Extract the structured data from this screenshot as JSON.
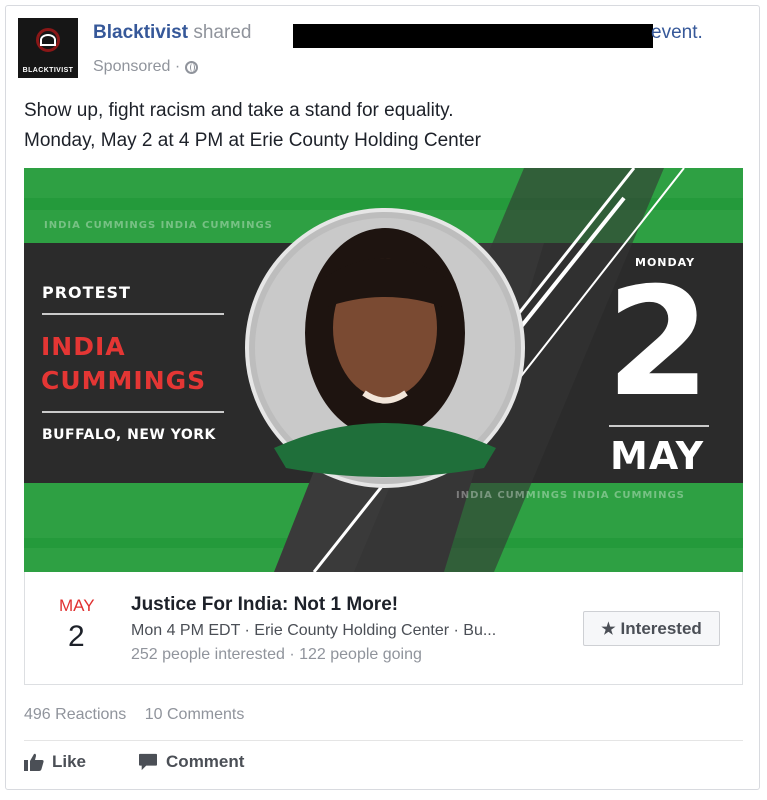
{
  "post": {
    "page_name": "Blacktivist",
    "shared_text": "shared",
    "event_word": "event.",
    "sponsored": "Sponsored ·",
    "avatar_text": "BLACKTIVIST",
    "message_line1": "Show up, fight racism and take a stand for equality.",
    "message_line2": "Monday, May 2 at 4 PM at Erie County Holding Center"
  },
  "banner": {
    "protest": "PROTEST",
    "name_line1": "INDIA",
    "name_line2": "CUMMINGS",
    "city": "BUFFALO, NEW YORK",
    "weekday": "MONDAY",
    "day": "2",
    "month": "MAY",
    "watermark": "INDIA CUMMINGS INDIA CUMMINGS"
  },
  "event": {
    "month": "MAY",
    "day": "2",
    "title": "Justice For India: Not 1 More!",
    "details": "Mon 4 PM EDT · Erie County Holding Center · Bu...",
    "stats": "252 people interested · 122 people going",
    "interested_label": "Interested"
  },
  "engagement": {
    "reactions": "496 Reactions",
    "comments": "10 Comments"
  },
  "actions": {
    "like": "Like",
    "comment": "Comment"
  },
  "colors": {
    "link": "#365899",
    "banner_green": "#2ea043",
    "banner_dark": "#2b2b2b",
    "accent_red": "#e43634"
  }
}
